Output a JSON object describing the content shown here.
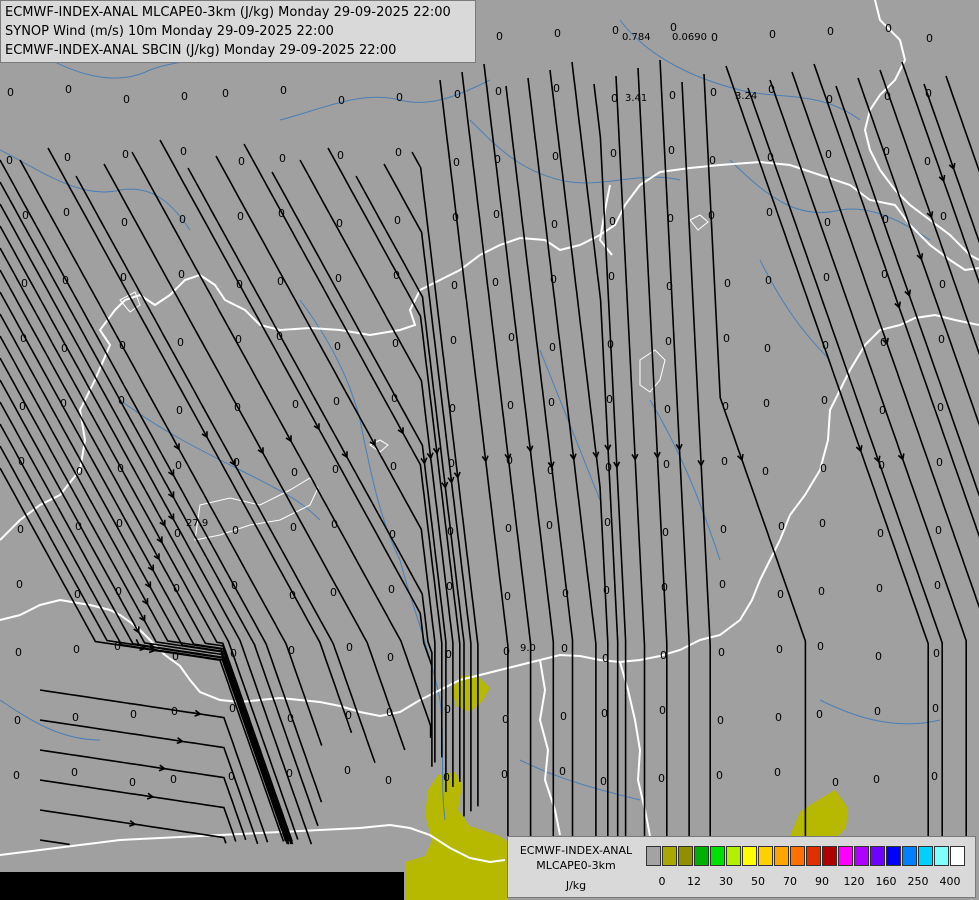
{
  "title_lines": [
    "ECMWF-INDEX-ANAL MLCAPE0-3km (J/kg) Monday 29-09-2025 22:00",
    "SYNOP Wind (m/s) 10m Monday 29-09-2025 22:00",
    "ECMWF-INDEX-ANAL SBCIN (J/kg) Monday 29-09-2025 22:00"
  ],
  "legend": {
    "name_line1": "ECMWF-INDEX-ANAL",
    "name_line2": "MLCAPE0-3km",
    "unit": "J/kg",
    "colors": [
      "#a3a3a3",
      "#a8a800",
      "#8f8f00",
      "#00b000",
      "#00e000",
      "#b0f000",
      "#ffff00",
      "#ffd000",
      "#ffa500",
      "#ff7000",
      "#e03000",
      "#b00000",
      "#ff00ff",
      "#b000ff",
      "#7000ff",
      "#0000ff",
      "#0080ff",
      "#00d0ff",
      "#80ffff",
      "#ffffff"
    ],
    "ticks": [
      "0",
      "12",
      "30",
      "50",
      "70",
      "90",
      "120",
      "160",
      "250",
      "400"
    ]
  },
  "map_labels": {
    "cape_top": [
      "0.784",
      "0.0690",
      "3.41",
      "3.24"
    ],
    "cape_mid": [
      "27.9",
      "9.0"
    ]
  },
  "colors": {
    "background": "#a0a0a0",
    "cape_fill": "#b7b800",
    "border": "#ffffff",
    "river": "#4a7fb5",
    "streamline": "#000000"
  }
}
